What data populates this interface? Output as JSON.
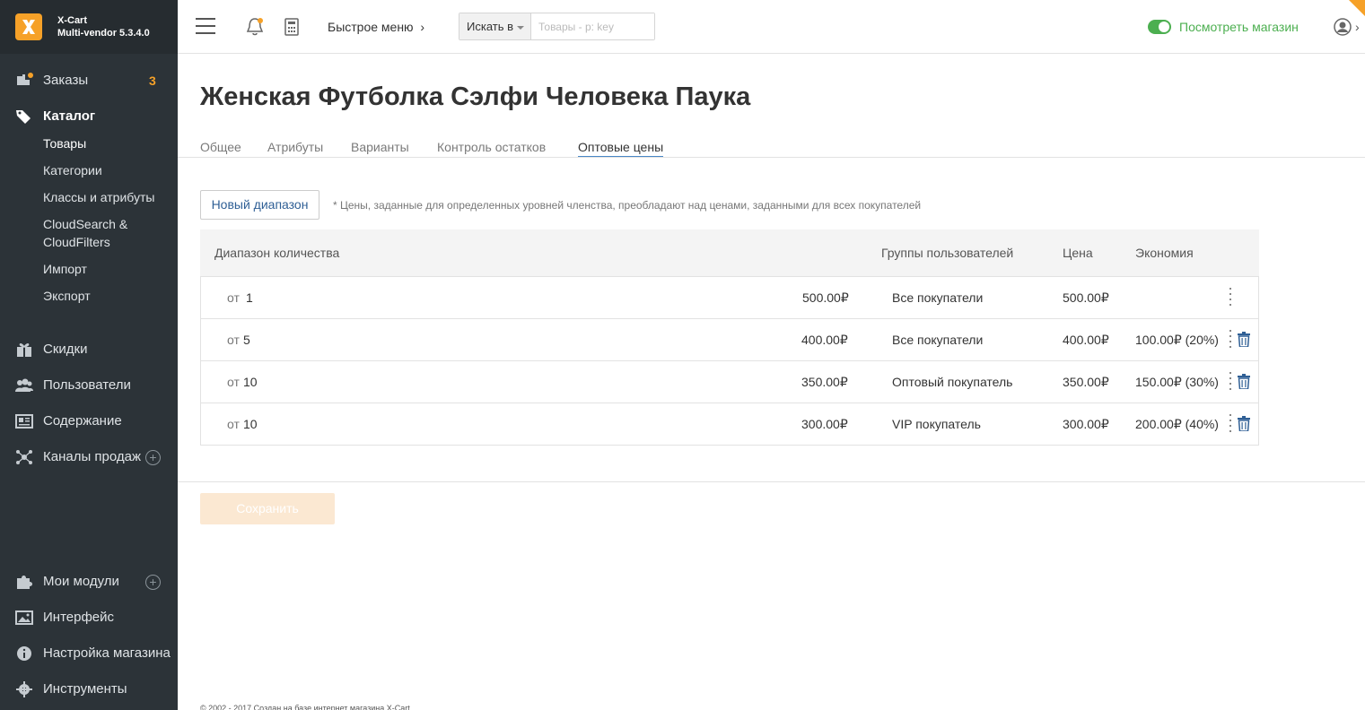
{
  "brand": {
    "name": "X-Cart",
    "version": "Multi-vendor 5.3.4.0"
  },
  "sidebar": {
    "orders": {
      "label": "Заказы",
      "badge": "3"
    },
    "catalog": {
      "label": "Каталог",
      "items": [
        "Товары",
        "Категории",
        "Классы и атрибуты",
        "CloudSearch &",
        "CloudFilters",
        "Импорт",
        "Экспорт"
      ]
    },
    "discounts": "Скидки",
    "users": "Пользователи",
    "content": "Содержание",
    "sales_channels": "Каналы продаж",
    "my_modules": "Мои модули",
    "look_feel": "Интерфейс",
    "store_setup": "Настройка магазина",
    "tools": "Инструменты"
  },
  "topbar": {
    "quick_menu": "Быстрое меню",
    "search_in": "Искать в",
    "search_placeholder": "Товары - p: key",
    "view_store": "Посмотреть магазин"
  },
  "page": {
    "title": "Женская Футболка Сэлфи Человека Паука",
    "tabs": [
      "Общее",
      "Атрибуты",
      "Варианты",
      "Контроль остатков",
      "Оптовые цены"
    ]
  },
  "wholesale": {
    "new_range_label": "Новый диапазон",
    "note": "* Цены, заданные для определенных уровней членства, преобладают над ценами, заданными для всех покупателей",
    "headers": {
      "range": "Диапазон количества",
      "groups": "Группы пользователей",
      "price": "Цена",
      "savings": "Экономия"
    },
    "rows": [
      {
        "from": "от",
        "qty": "1",
        "price_input": "500.00₽",
        "group": "Все покупатели",
        "price": "500.00₽",
        "savings": ""
      },
      {
        "from": "от",
        "qty": "5",
        "price_input": "400.00₽",
        "group": "Все покупатели",
        "price": "400.00₽",
        "savings": "100.00₽ (20%)"
      },
      {
        "from": "от",
        "qty": "10",
        "price_input": "350.00₽",
        "group": "Оптовый покупатель",
        "price": "350.00₽",
        "savings": "150.00₽ (30%)"
      },
      {
        "from": "от",
        "qty": "10",
        "price_input": "300.00₽",
        "group": "VIP покупатель",
        "price": "300.00₽",
        "savings": "200.00₽ (40%)"
      }
    ],
    "save_label": "Сохранить"
  },
  "footer": {
    "copyright": "© 2002 - 2017 Создан на базе интернет магазина X-Cart"
  },
  "colors": {
    "sidebar_bg": "#2c3338",
    "accent": "#f6a128",
    "link": "#2f5f95",
    "green": "#4caf50"
  }
}
